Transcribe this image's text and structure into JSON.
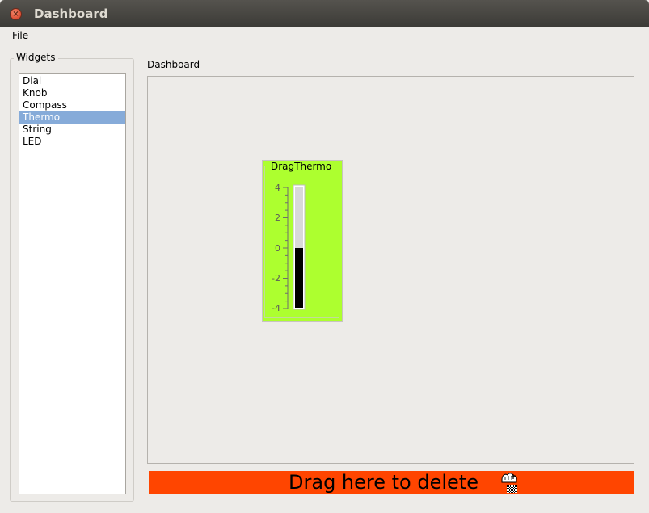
{
  "window": {
    "title": "Dashboard"
  },
  "menu": {
    "file": "File"
  },
  "widgets": {
    "title": "Widgets",
    "items": [
      "Dial",
      "Knob",
      "Compass",
      "Thermo",
      "String",
      "LED"
    ],
    "selected": "Thermo"
  },
  "dashboard": {
    "label": "Dashboard"
  },
  "thermo": {
    "title": "DragThermo",
    "ticks": [
      "4",
      "2",
      "0",
      "-2",
      "-4"
    ],
    "min": -4,
    "max": 4,
    "value": 0,
    "background": "#adff2f",
    "fill": "#000000"
  },
  "delete_zone": {
    "label": "Drag here to delete",
    "color": "#ff4500"
  },
  "icons": {
    "close": "close-icon",
    "cursor": "drag-copy-cursor-icon"
  }
}
